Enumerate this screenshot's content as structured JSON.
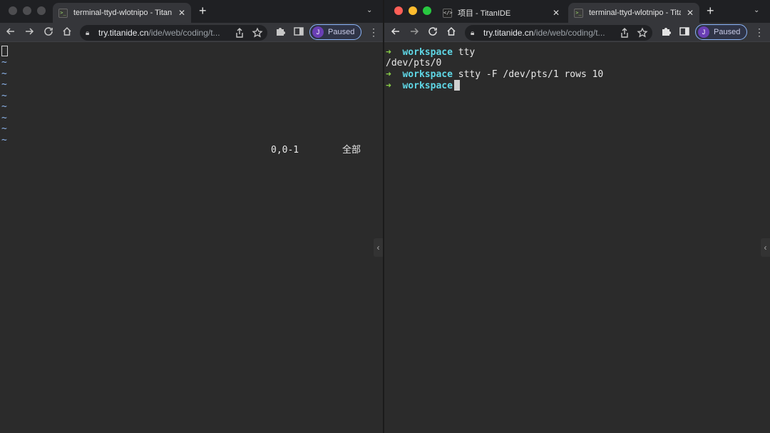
{
  "left_window": {
    "tab_title": "terminal-ttyd-wlotnipo - TitanIDE",
    "favicon": "terminal-prompt-icon",
    "url_host": "try.titanide.cn",
    "url_path": "/ide/web/coding/t...",
    "profile_initial": "J",
    "profile_status": "Paused",
    "vim": {
      "tilde_lines": [
        "~",
        "~",
        "~",
        "~",
        "~",
        "~",
        "~",
        "~"
      ],
      "ruler_position": "0,0-1",
      "ruler_scroll": "全部"
    }
  },
  "right_window": {
    "tabs": [
      {
        "title": "项目 - TitanIDE",
        "favicon": "code-brackets-icon"
      },
      {
        "title": "terminal-ttyd-wlotnipo - TitanIDE",
        "favicon": "terminal-prompt-icon"
      }
    ],
    "url_host": "try.titanide.cn",
    "url_path": "/ide/web/coding/t...",
    "profile_initial": "J",
    "profile_status": "Paused",
    "terminal": {
      "prompt_arrow": "➜",
      "prompt_dir": "workspace",
      "cmd1": "tty",
      "out1": "/dev/pts/0",
      "cmd2": "stty -F /dev/pts/1 rows 10"
    }
  },
  "colors": {
    "tilde": "#8fb7f0",
    "prompt_arrow": "#8bd148",
    "prompt_dir": "#5fd7e6",
    "terminal_bg": "#2b2b2b",
    "profile_border": "#8ab4f8"
  }
}
